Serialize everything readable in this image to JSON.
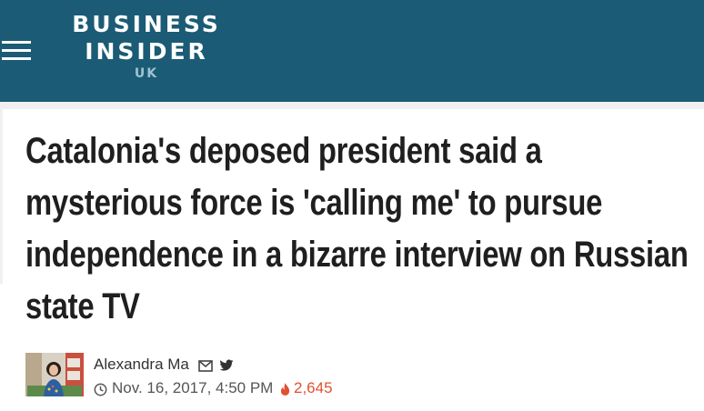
{
  "header": {
    "logo_line1": "BUSINESS",
    "logo_line2": "INSIDER",
    "logo_region": "UK",
    "background_color": "#1b5b75",
    "menu_icon": "hamburger-menu-icon"
  },
  "article": {
    "headline": "Catalonia's deposed president said a mysterious force is 'calling me' to pursue independence in a bizarre interview on Russian state TV",
    "author": "Alexandra Ma",
    "date": "Nov. 16, 2017, 4:50 PM",
    "views": "2,645",
    "icons": [
      "mail-icon",
      "twitter-icon",
      "clock-icon",
      "fire-icon"
    ],
    "views_color": "#e0512f"
  }
}
